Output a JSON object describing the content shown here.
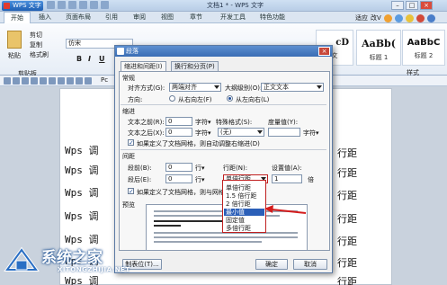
{
  "app": {
    "button": "WPS 文字",
    "title": "文档1 * - WPS 文字"
  },
  "ribbon_tabs": [
    "开始",
    "插入",
    "页面布局",
    "引用",
    "审阅",
    "视图",
    "章节",
    "开发工具",
    "特色功能"
  ],
  "tab_right": {
    "label": "适应",
    "dropdown": "改V"
  },
  "clipboard": {
    "paste": "粘贴",
    "cut": "剪切",
    "copy": "复制",
    "format_painter": "格式刷",
    "group": "剪贴板"
  },
  "font": {
    "name": "仿宋",
    "bold": "B",
    "italic": "I",
    "underline": "U"
  },
  "styles": {
    "items": [
      {
        "preview": "AaBb(",
        "name": "标题 1"
      },
      {
        "preview": "AaBbC",
        "name": "标题 2"
      }
    ],
    "partial": "cD",
    "partial_name": "文",
    "group": "样式"
  },
  "doc": {
    "lines": [
      "Wps 调",
      "Wps 调",
      "Wps 调",
      "Wps 调",
      "Wps 调",
      "Wps 调",
      "Wps 调"
    ],
    "right": [
      "行距",
      "行距",
      "行距",
      "行距",
      "行距",
      "行距",
      "行距"
    ],
    "partial_left": "Pc"
  },
  "dialog": {
    "title": "段落",
    "tabs": [
      "缩进和间距(I)",
      "换行和分页(P)"
    ],
    "general": {
      "heading": "常规",
      "align_label": "对齐方式(G):",
      "align_value": "两端对齐",
      "outline_label": "大纲级别(O):",
      "outline_value": "正文文本",
      "direction_label": "方向:",
      "rtl": "从右向左(F)",
      "ltr": "从左向右(L)"
    },
    "indent": {
      "heading": "缩进",
      "before_label": "文本之前(R):",
      "before_value": "0",
      "after_label": "文本之后(X):",
      "after_value": "0",
      "unit": "字符▾",
      "special_label": "特殊格式(S):",
      "special_value": "(无)",
      "measure_label": "度量值(Y):",
      "measure_unit": "字符▾",
      "grid_check": "如果定义了文档网格，则自动调整右缩进(D)"
    },
    "spacing": {
      "heading": "间距",
      "before_label": "段前(B):",
      "before_value": "0",
      "after_label": "段后(E):",
      "after_value": "0",
      "unit": "行▾",
      "line_label": "行距(N):",
      "line_value": "单倍行距",
      "set_label": "设置值(A):",
      "set_value": "1",
      "set_unit": "倍",
      "grid_check": "如果定义了文档网格，则与网格对齐(W)"
    },
    "dropdown_options": [
      "单倍行距",
      "1.5 倍行距",
      "2 倍行距",
      "最小值",
      "固定值",
      "多倍行距"
    ],
    "dropdown_selected": "最小值",
    "preview_label": "预览",
    "tab_button": "制表位(T)...",
    "ok": "确定",
    "cancel": "取消"
  },
  "watermark": {
    "title": "系统之家",
    "url": "XITONGZHIJIA.NET"
  }
}
